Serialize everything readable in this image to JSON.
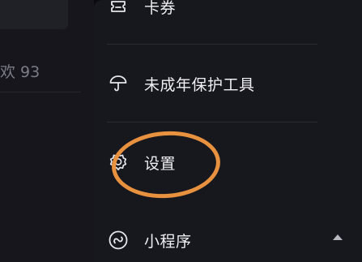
{
  "left_panel": {
    "stat_text": "欢 93"
  },
  "menu": {
    "items": [
      {
        "label": "卡券",
        "icon": "ticket-icon"
      },
      {
        "label": "未成年保护工具",
        "icon": "umbrella-icon"
      },
      {
        "label": "设置",
        "icon": "gear-icon"
      },
      {
        "label": "小程序",
        "icon": "mini-program-icon"
      }
    ],
    "expand_icon": "chevron-up-icon"
  },
  "colors": {
    "background": "#0b0b0f",
    "drawer": "#17171e",
    "highlight_circle": "#e8913f",
    "text": "#f0f0f4"
  }
}
